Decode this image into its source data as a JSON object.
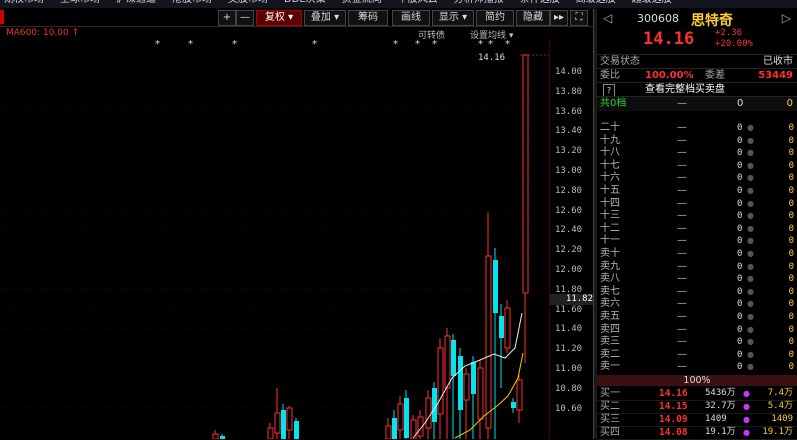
{
  "top_tabs": [
    "期权市场",
    "全球市场",
    "沪深通道",
    "港股市场",
    "美股市场",
    "DDE决策",
    "资金流向",
    "个股风云",
    "分析师播报",
    "条件选股",
    "高级选股",
    "超级选股"
  ],
  "toolbar": {
    "plus": "+",
    "minus": "—",
    "fuquan": "复权",
    "diejia": "叠加",
    "chouma": "筹码",
    "quxian": "画线",
    "xianshi": "显示",
    "jianyue": "简约",
    "yincang": "隐藏",
    "next": "▸▸",
    "expand": "⛶"
  },
  "ma_label": "MA600: 10.00 ↑",
  "links": {
    "convertible": "可转债",
    "settings": "设置均线"
  },
  "last_price_label": "14.16",
  "axis_ticks": [
    "14.00",
    "13.80",
    "13.60",
    "13.40",
    "13.20",
    "13.00",
    "12.80",
    "12.60",
    "12.40",
    "12.20",
    "12.00",
    "11.80",
    "11.60",
    "11.40",
    "11.20",
    "11.00",
    "10.80",
    "10.60"
  ],
  "current_price_marker": "11.82",
  "stock": {
    "code": "300608",
    "name": "思特奇",
    "price": "14.16",
    "change": "+2.36",
    "change_pct": "+20.00%"
  },
  "trade_status": {
    "label": "交易状态",
    "value": "已收市"
  },
  "ratio": {
    "label": "委比",
    "value": "100.00%",
    "diff_label": "委差",
    "diff_value": "53449"
  },
  "full_book": {
    "help": "?",
    "label": "查看完整档买卖盘"
  },
  "total_levels": {
    "label": "共0档",
    "dash": "—",
    "v1": "0",
    "v2": "0"
  },
  "sell_levels": [
    {
      "label": "二十",
      "price": "—",
      "vol": "0",
      "extra": "0"
    },
    {
      "label": "十九",
      "price": "—",
      "vol": "0",
      "extra": "0"
    },
    {
      "label": "十八",
      "price": "—",
      "vol": "0",
      "extra": "0"
    },
    {
      "label": "十七",
      "price": "—",
      "vol": "0",
      "extra": "0"
    },
    {
      "label": "十六",
      "price": "—",
      "vol": "0",
      "extra": "0"
    },
    {
      "label": "十五",
      "price": "—",
      "vol": "0",
      "extra": "0"
    },
    {
      "label": "十四",
      "price": "—",
      "vol": "0",
      "extra": "0"
    },
    {
      "label": "十三",
      "price": "—",
      "vol": "0",
      "extra": "0"
    },
    {
      "label": "十二",
      "price": "—",
      "vol": "0",
      "extra": "0"
    },
    {
      "label": "十一",
      "price": "—",
      "vol": "0",
      "extra": "0"
    },
    {
      "label": "卖十",
      "price": "—",
      "vol": "0",
      "extra": "0"
    },
    {
      "label": "卖九",
      "price": "—",
      "vol": "0",
      "extra": "0"
    },
    {
      "label": "卖八",
      "price": "—",
      "vol": "0",
      "extra": "0"
    },
    {
      "label": "卖七",
      "price": "—",
      "vol": "0",
      "extra": "0"
    },
    {
      "label": "卖六",
      "price": "—",
      "vol": "0",
      "extra": "0"
    },
    {
      "label": "卖五",
      "price": "—",
      "vol": "0",
      "extra": "0"
    },
    {
      "label": "卖四",
      "price": "—",
      "vol": "0",
      "extra": "0"
    },
    {
      "label": "卖三",
      "price": "—",
      "vol": "0",
      "extra": "0"
    },
    {
      "label": "卖二",
      "price": "—",
      "vol": "0",
      "extra": "0"
    },
    {
      "label": "卖一",
      "price": "—",
      "vol": "0",
      "extra": "0"
    }
  ],
  "buy_pct": "100%",
  "buy_levels": [
    {
      "label": "买一",
      "price": "14.16",
      "vol": "5436万",
      "extra": "7.4万"
    },
    {
      "label": "买二",
      "price": "14.15",
      "vol": "32.7万",
      "extra": "5.4万"
    },
    {
      "label": "买三",
      "price": "14.09",
      "vol": "1409",
      "extra": "1409"
    },
    {
      "label": "买四",
      "price": "14.08",
      "vol": "19.1万",
      "extra": "19.1万"
    }
  ],
  "colors": {
    "up": "#ff3030",
    "down": "#00e5ee",
    "accent": "#ffcc33"
  }
}
